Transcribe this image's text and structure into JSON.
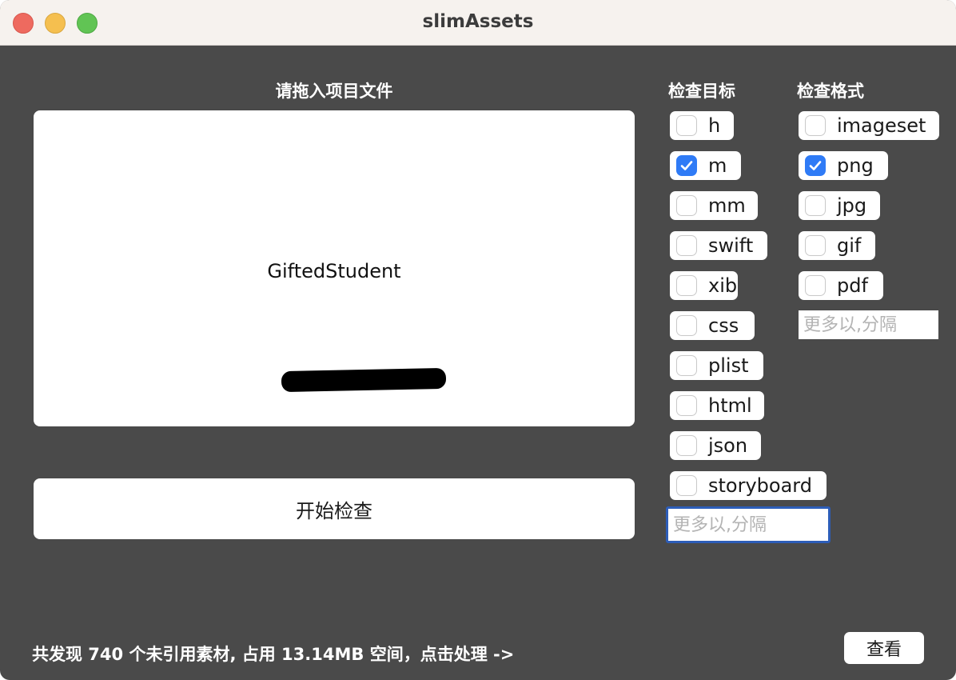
{
  "window": {
    "title": "slimAssets"
  },
  "drop": {
    "heading": "请拖入项目文件",
    "project_name": "GiftedStudent"
  },
  "start_button": "开始检查",
  "targets": {
    "heading": "检查目标",
    "items": [
      {
        "label": "h",
        "checked": false
      },
      {
        "label": "m",
        "checked": true
      },
      {
        "label": "mm",
        "checked": false
      },
      {
        "label": "swift",
        "checked": false
      },
      {
        "label": "xib",
        "checked": false
      },
      {
        "label": "css",
        "checked": false
      },
      {
        "label": "plist",
        "checked": false
      },
      {
        "label": "html",
        "checked": false
      },
      {
        "label": "json",
        "checked": false
      },
      {
        "label": "storyboard",
        "checked": false
      }
    ],
    "more_placeholder": "更多以,分隔",
    "more_value": ""
  },
  "formats": {
    "heading": "检查格式",
    "items": [
      {
        "label": "imageset",
        "checked": false
      },
      {
        "label": "png",
        "checked": true
      },
      {
        "label": "jpg",
        "checked": false
      },
      {
        "label": "gif",
        "checked": false
      },
      {
        "label": "pdf",
        "checked": false
      }
    ],
    "more_placeholder": "更多以,分隔",
    "more_value": ""
  },
  "status": "共发现 740 个未引用素材, 占用 13.14MB 空间，点击处理 ->",
  "view_button": "查看",
  "colors": {
    "window_bg": "#4a4a4a",
    "titlebar_bg": "#f6f2ee",
    "checkbox_on": "#2f7bf6",
    "focus_ring": "#2d5db8"
  }
}
